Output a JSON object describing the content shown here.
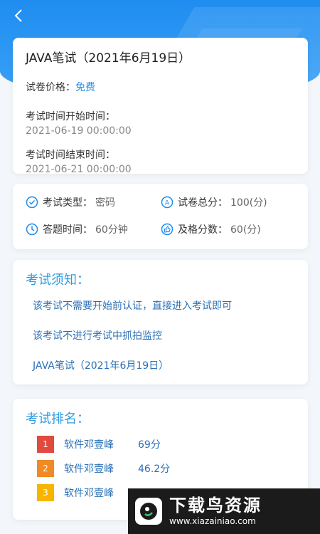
{
  "exam": {
    "title": "JAVA笔试（2021年6月19日）",
    "price_label": "试卷价格：",
    "price": "免费",
    "start_label": "考试时间开始时间：",
    "start_time": "2021-06-19 00:00:00",
    "end_label": "考试时间结束时间：",
    "end_time": "2021-06-21 00:00:00"
  },
  "stats": {
    "type_label": "考试类型：",
    "type_value": "密码",
    "total_label": "试卷总分：",
    "total_value": "100(分)",
    "duration_label": "答题时间：",
    "duration_value": "60分钟",
    "pass_label": "及格分数：",
    "pass_value": "60(分)"
  },
  "notice": {
    "title": "考试须知：",
    "items": [
      "该考试不需要开始前认证，直接进入考试即可",
      "该考试不进行考试中抓拍监控",
      "JAVA笔试（2021年6月19日）"
    ]
  },
  "ranking": {
    "title": "考试排名：",
    "rows": [
      {
        "rank": "1",
        "name": "软件邓壹峰",
        "score": "69分",
        "color": "#e04a3f"
      },
      {
        "rank": "2",
        "name": "软件邓壹峰",
        "score": "46.2分",
        "color": "#f08a24"
      },
      {
        "rank": "3",
        "name": "软件邓壹峰",
        "score": "",
        "color": "#f7b500"
      }
    ]
  },
  "watermark": {
    "title": "下载鸟资源",
    "url": "www.xiazainiao.com"
  },
  "colors": {
    "accent": "#1f8df0",
    "link": "#2b6fb4"
  }
}
